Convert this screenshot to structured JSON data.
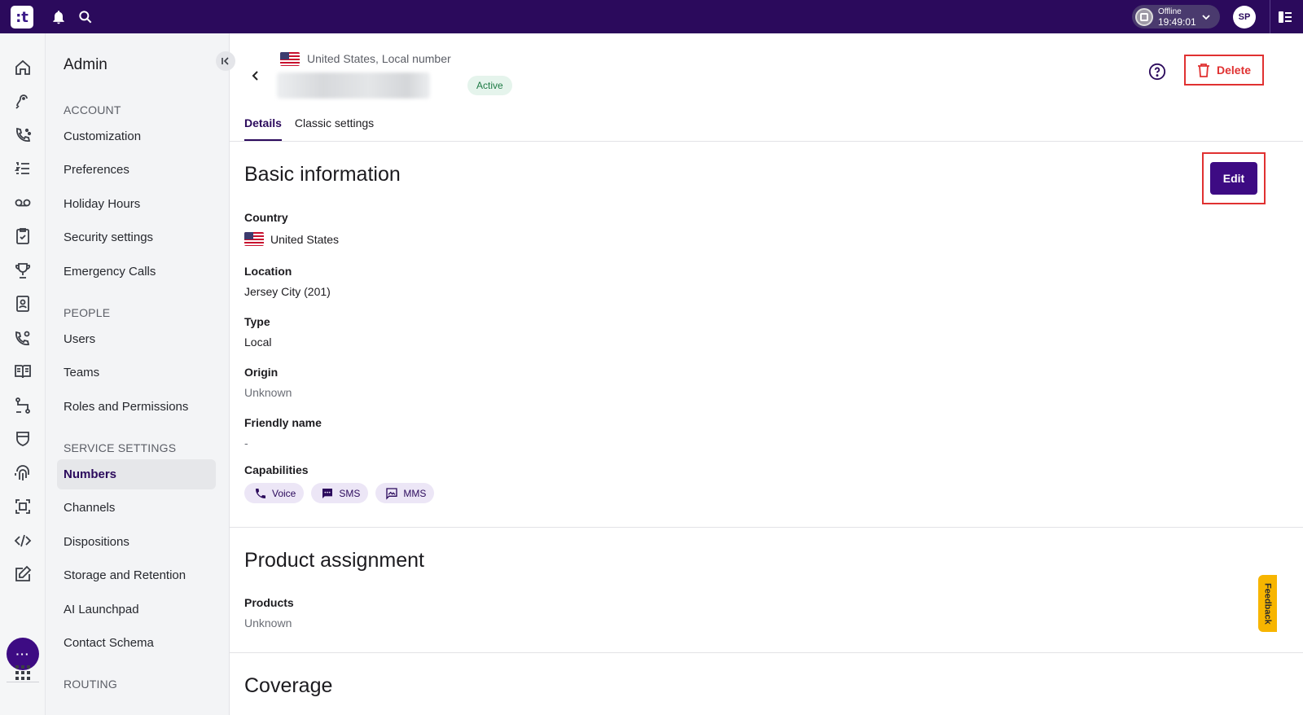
{
  "topbar": {
    "logo_text": ":t",
    "status_label": "Offline",
    "status_time": "19:49:01",
    "avatar_initials": "SP"
  },
  "nav": {
    "title": "Admin",
    "sections": [
      {
        "label": "ACCOUNT",
        "items": [
          "Customization",
          "Preferences",
          "Holiday Hours",
          "Security settings",
          "Emergency Calls"
        ]
      },
      {
        "label": "PEOPLE",
        "items": [
          "Users",
          "Teams",
          "Roles and Permissions"
        ]
      },
      {
        "label": "SERVICE SETTINGS",
        "items": [
          "Numbers",
          "Channels",
          "Dispositions",
          "Storage and Retention",
          "AI Launchpad",
          "Contact Schema"
        ]
      },
      {
        "label": "ROUTING",
        "items": []
      }
    ],
    "active_item": "Numbers",
    "more_label": "···"
  },
  "header": {
    "subtitle": "United States, Local number",
    "status_badge": "Active",
    "delete_label": "Delete"
  },
  "tabs": [
    "Details",
    "Classic settings"
  ],
  "basic_info": {
    "title": "Basic information",
    "edit_label": "Edit",
    "fields": {
      "country_label": "Country",
      "country_value": "United States",
      "location_label": "Location",
      "location_value": "Jersey City (201)",
      "type_label": "Type",
      "type_value": "Local",
      "origin_label": "Origin",
      "origin_value": "Unknown",
      "friendly_label": "Friendly name",
      "friendly_value": "-",
      "capabilities_label": "Capabilities"
    },
    "capabilities": [
      "Voice",
      "SMS",
      "MMS"
    ]
  },
  "product_assignment": {
    "title": "Product assignment",
    "products_label": "Products",
    "products_value": "Unknown"
  },
  "coverage": {
    "title": "Coverage"
  },
  "feedback_label": "Feedback",
  "colors": {
    "brand": "#2b0a5c",
    "accent": "#3d0b83",
    "danger": "#e03131",
    "feedback": "#f7b500"
  }
}
